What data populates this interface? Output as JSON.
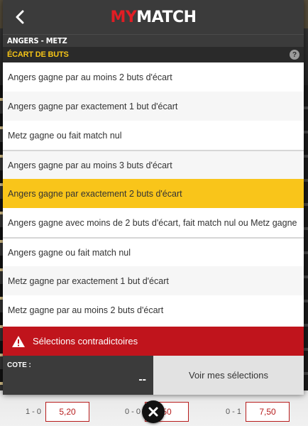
{
  "header": {
    "logo_my": "MY",
    "logo_match": "MATCH"
  },
  "match": {
    "title": "ANGERS - METZ"
  },
  "section": {
    "title": "ÉCART DE BUTS",
    "help": "?"
  },
  "options": [
    {
      "label": "Angers gagne par au moins 2 buts d'écart",
      "selected": false
    },
    {
      "label": "Angers gagne par exactement 1 but d'écart",
      "selected": false
    },
    {
      "label": "Metz gagne ou fait match nul",
      "selected": false
    },
    {
      "label": "Angers gagne par au moins 3 buts d'écart",
      "selected": false
    },
    {
      "label": "Angers gagne par exactement 2 buts d'écart",
      "selected": true
    },
    {
      "label": "Angers gagne avec moins de 2 buts d'écart, fait match nul ou Metz gagne",
      "selected": false
    },
    {
      "label": "Angers gagne ou fait match nul",
      "selected": false
    },
    {
      "label": "Metz gagne par exactement 1 but d'écart",
      "selected": false
    },
    {
      "label": "Metz gagne par au moins 2 buts d'écart",
      "selected": false
    }
  ],
  "warning": {
    "text": "Sélections contradictoires"
  },
  "footer": {
    "cote_label": "COTE :",
    "cote_value": "--",
    "voir_label": "Voir mes sélections"
  },
  "odds_row": [
    {
      "score": "1 - 0",
      "odd": "5,20"
    },
    {
      "score": "0 - 0",
      "odd": "50"
    },
    {
      "score": "0 - 1",
      "odd": "7,50"
    }
  ],
  "colors": {
    "accent": "#f9c51a",
    "brand_red": "#e11d24",
    "warning_red": "#c0141c",
    "header_dark": "#3b3b3b"
  }
}
